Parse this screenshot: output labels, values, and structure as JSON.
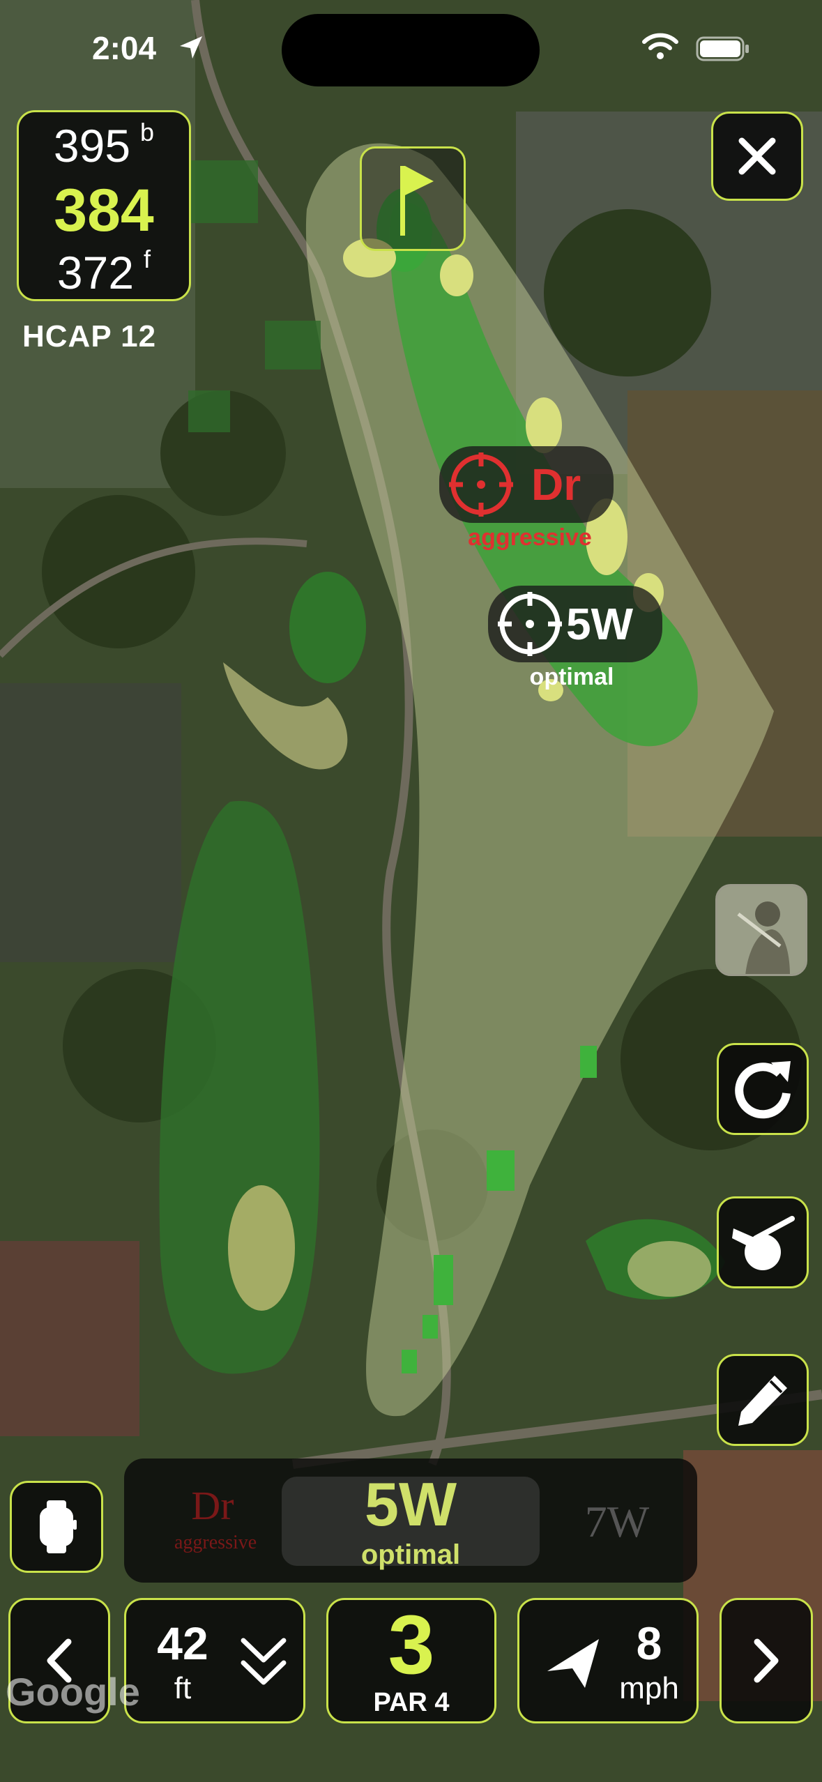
{
  "status_bar": {
    "time": "2:04"
  },
  "distances": {
    "back": "395",
    "back_suffix": "b",
    "middle": "384",
    "front": "372",
    "front_suffix": "f"
  },
  "handicap": "HCAP 12",
  "aim_targets": [
    {
      "club": "Dr",
      "strategy": "aggressive",
      "color": "#e03030"
    },
    {
      "club": "5W",
      "strategy": "optimal",
      "color": "#ffffff"
    }
  ],
  "club_selector": {
    "prev": {
      "club": "Dr",
      "strategy": "aggressive"
    },
    "current": {
      "club": "5W",
      "strategy": "optimal"
    },
    "next": {
      "club": "7W"
    }
  },
  "bottom": {
    "elevation_value": "42",
    "elevation_unit": "ft",
    "hole_number": "3",
    "par": "PAR 4",
    "wind_speed": "8",
    "wind_unit": "mph"
  },
  "map_attribution": "Google",
  "colors": {
    "accent": "#c9e24a",
    "highlight": "#d9f24f",
    "aggressive": "#e03030"
  },
  "icons": [
    "location-arrow-icon",
    "wifi-icon",
    "battery-icon",
    "flag-icon",
    "close-icon",
    "player-avatar-icon",
    "rotate-icon",
    "club-ball-icon",
    "pencil-icon",
    "watch-icon",
    "chevron-left-icon",
    "elevation-down-icon",
    "wind-arrow-icon",
    "chevron-right-icon",
    "target-icon"
  ]
}
